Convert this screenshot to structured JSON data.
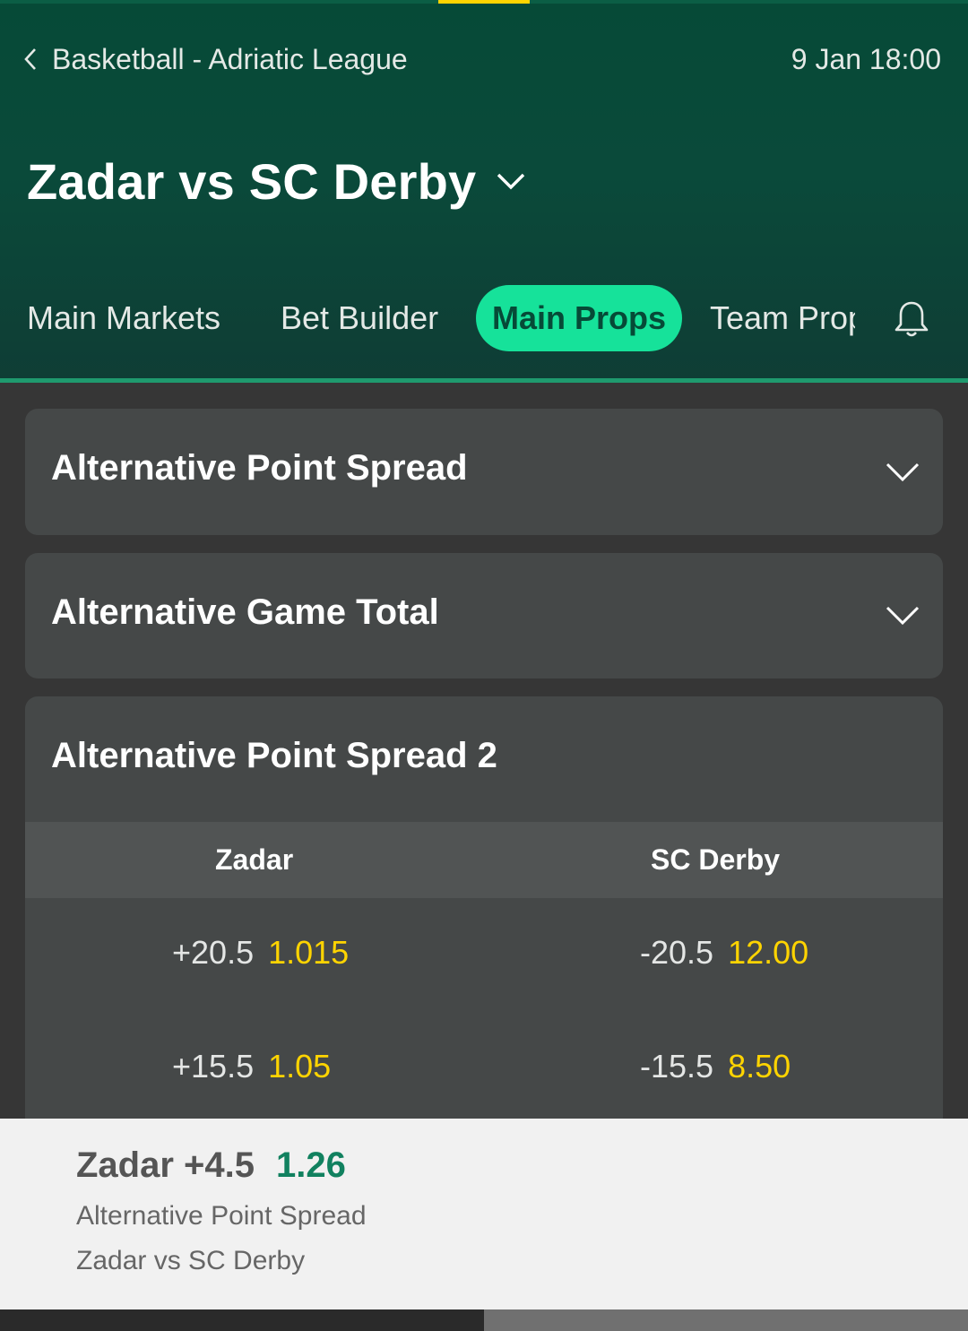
{
  "header": {
    "breadcrumb": "Basketball - Adriatic League",
    "datetime": "9 Jan 18:00",
    "match_title": "Zadar vs SC Derby",
    "icons": {
      "back": "chevron-left-icon",
      "title": "chevron-down-icon",
      "alerts": "bell-icon"
    }
  },
  "tabs": [
    {
      "label": "Main Markets",
      "active": false
    },
    {
      "label": "Bet Builder",
      "active": false
    },
    {
      "label": "Main Props",
      "active": true
    },
    {
      "label": "Team Props",
      "active": false
    }
  ],
  "markets": [
    {
      "title": "Alternative Point Spread",
      "expanded": false
    },
    {
      "title": "Alternative Game Total",
      "expanded": false
    },
    {
      "title": "Alternative Point Spread 2",
      "expanded": true,
      "columns": [
        "Zadar",
        "SC Derby"
      ],
      "rows": [
        {
          "home_line": "+20.5",
          "home_price": "1.015",
          "away_line": "-20.5",
          "away_price": "12.00"
        },
        {
          "home_line": "+15.5",
          "home_price": "1.05",
          "away_line": "-15.5",
          "away_price": "8.50"
        }
      ]
    }
  ],
  "betslip": {
    "selection": "Zadar +4.5",
    "odds": "1.26",
    "market": "Alternative Point Spread",
    "event": "Zadar vs SC Derby"
  },
  "colors": {
    "header_green": "#064a37",
    "active_tab": "#16e29a",
    "odds_yellow": "#ffd400",
    "betslip_odds_green": "#11815f",
    "card_bg": "#454848"
  }
}
